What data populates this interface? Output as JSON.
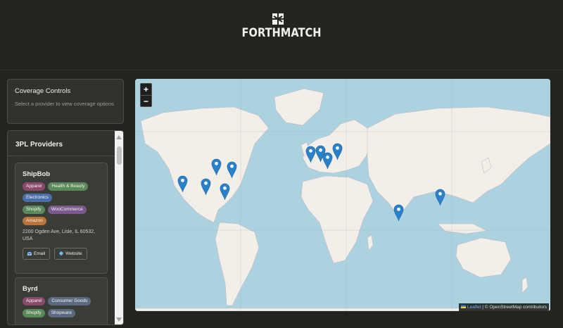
{
  "brand": {
    "name": "FORTHMATCH",
    "logo_icon": "puzzle-mark-icon"
  },
  "coverage_controls": {
    "title": "Coverage Controls",
    "hint": "Select a provider to view coverage options"
  },
  "providers_panel": {
    "title": "3PL Providers",
    "providers": [
      {
        "name": "ShipBob",
        "categories": [
          {
            "label": "Apparel",
            "color": "#8a4a6c"
          },
          {
            "label": "Health & Beauty",
            "color": "#5a8a5a"
          },
          {
            "label": "Electronics",
            "color": "#4a6fa8"
          }
        ],
        "platforms": [
          {
            "label": "Shopify",
            "color": "#5a8a5a"
          },
          {
            "label": "WooCommerce",
            "color": "#7a5a8c"
          },
          {
            "label": "Amazon",
            "color": "#b8743a"
          }
        ],
        "address": "2200 Ogden Ave, Lisle, IL 60532, USA",
        "email_label": "Email",
        "website_label": "Website"
      },
      {
        "name": "Byrd",
        "categories": [
          {
            "label": "Apparel",
            "color": "#8a4a6c"
          },
          {
            "label": "Consumer Goods",
            "color": "#5b6a80"
          }
        ],
        "platforms": [
          {
            "label": "Shopify",
            "color": "#5a8a5a"
          },
          {
            "label": "Shopware",
            "color": "#5b6a80"
          }
        ]
      }
    ]
  },
  "map": {
    "zoom_in_label": "+",
    "zoom_out_label": "−",
    "attribution_library": "Leaflet",
    "attribution_separator": " | © ",
    "attribution_text": "OpenStreetMap contributors",
    "marker_color": "#2a81cb",
    "marker_locations": [
      "Western US",
      "Central US",
      "Great Lakes",
      "US Northeast",
      "US Southeast",
      "United Kingdom",
      "Netherlands",
      "Central Europe",
      "Scandinavia",
      "India",
      "China"
    ]
  }
}
